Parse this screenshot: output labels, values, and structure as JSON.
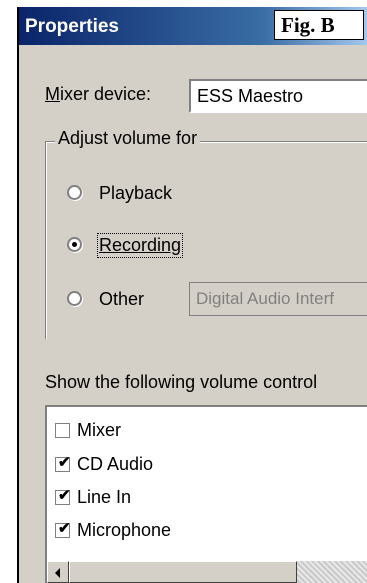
{
  "title": "Properties",
  "fig_label": "Fig. B",
  "mixer": {
    "label": "Mixer device:",
    "label_accel": "M",
    "label_rest": "ixer device:",
    "value": "ESS Maestro"
  },
  "adjust": {
    "legend": "Adjust volume for",
    "options": [
      {
        "label": "Playback",
        "selected": false
      },
      {
        "label": "Recording",
        "selected": true
      },
      {
        "label": "Other",
        "selected": false
      }
    ],
    "other_value": "Digital Audio Interf"
  },
  "show_label": "Show the following volume control",
  "controls": [
    {
      "label": "Mixer",
      "checked": false
    },
    {
      "label": "CD Audio",
      "checked": true
    },
    {
      "label": "Line In",
      "checked": true
    },
    {
      "label": "Microphone",
      "checked": true
    }
  ]
}
